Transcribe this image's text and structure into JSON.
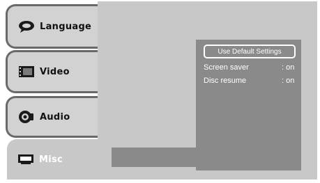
{
  "tabs": [
    {
      "label": "Language",
      "icon": "speech-bubble-icon"
    },
    {
      "label": "Video",
      "icon": "film-icon"
    },
    {
      "label": "Audio",
      "icon": "speaker-icon"
    },
    {
      "label": "Misc",
      "icon": "monitor-icon"
    }
  ],
  "selected_tab": "Misc",
  "content": {
    "default_button_label": "Use Default Settings",
    "settings": [
      {
        "name": "Screen saver",
        "value": ": on"
      },
      {
        "name": "Disc resume",
        "value": ": on"
      }
    ]
  },
  "colors": {
    "panel": "#c8c8c8",
    "content_box": "#8a8a8a",
    "tab_border": "#6a6a6a",
    "text_light": "#ffffff"
  }
}
